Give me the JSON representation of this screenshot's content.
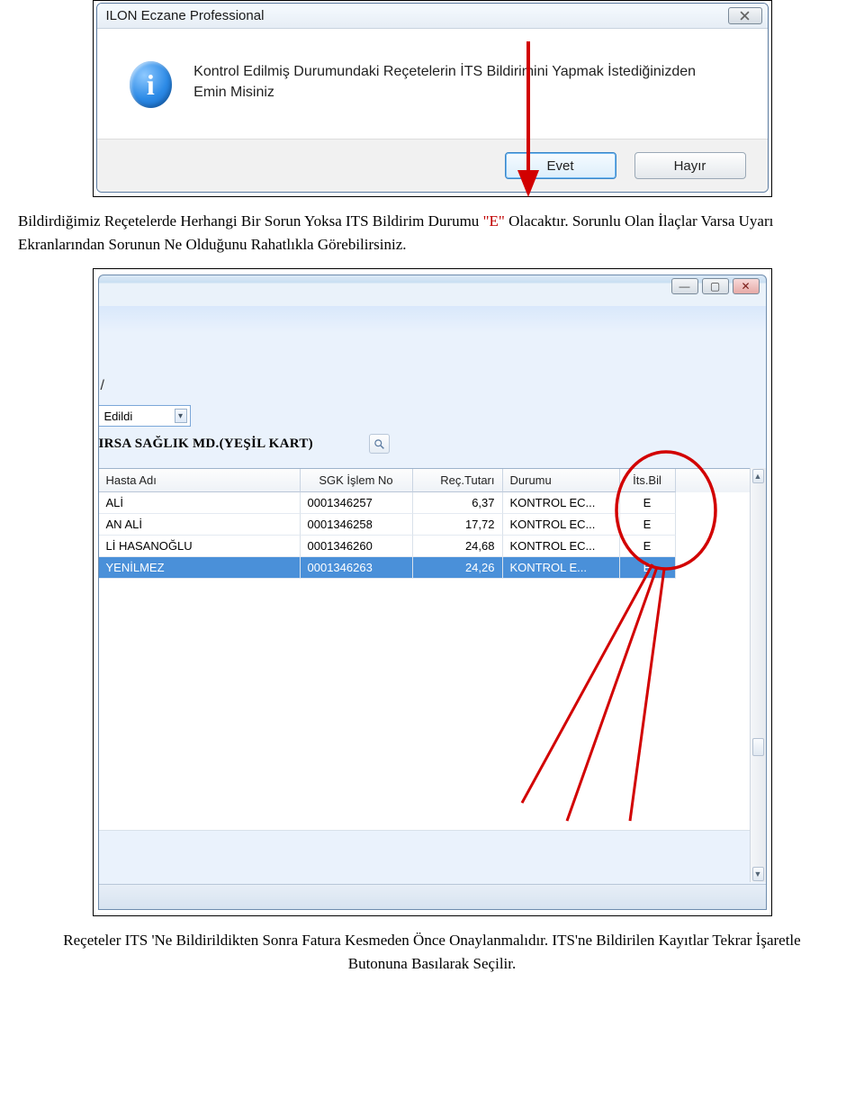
{
  "dialog": {
    "title": "ILON Eczane Professional",
    "info_glyph": "i",
    "message": "Kontrol Edilmiş Durumundaki Reçetelerin İTS Bildirimini Yapmak İstediğinizden Emin Misiniz",
    "yes": "Evet",
    "no": "Hayır"
  },
  "caption1_pre": "Bildirdiğimiz Reçetelerde Herhangi Bir Sorun Yoksa ITS Bildirim Durumu ",
  "caption1_red": "\"E\"",
  "caption1_post": " Olacaktır.  Sorunlu Olan İlaçlar Varsa  Uyarı Ekranlarından Sorunun Ne Olduğunu Rahatlıkla Görebilirsiniz.",
  "window2": {
    "combo_value": "Edildi",
    "header_label": "IRSA SAĞLIK MD.(YEŞİL KART)",
    "columns": [
      "Hasta Adı",
      "SGK İşlem No",
      "Reç.Tutarı",
      "Durumu",
      "İts.Bil"
    ],
    "rows": [
      {
        "hasta": "ALİ",
        "sgk": "0001346257",
        "tutar": "6,37",
        "durum": "KONTROL EC...",
        "its": "E",
        "selected": false
      },
      {
        "hasta": "AN ALİ",
        "sgk": "0001346258",
        "tutar": "17,72",
        "durum": "KONTROL EC...",
        "its": "E",
        "selected": false
      },
      {
        "hasta": "Lİ HASANOĞLU",
        "sgk": "0001346260",
        "tutar": "24,68",
        "durum": "KONTROL EC...",
        "its": "E",
        "selected": false
      },
      {
        "hasta": "YENİLMEZ",
        "sgk": "0001346263",
        "tutar": "24,26",
        "durum": "KONTROL E...",
        "its": "E",
        "selected": true
      }
    ]
  },
  "caption2": "Reçeteler ITS 'Ne Bildirildikten Sonra Fatura Kesmeden Önce Onaylanmalıdır. ITS'ne Bildirilen Kayıtlar Tekrar İşaretle Butonuna Basılarak Seçilir."
}
